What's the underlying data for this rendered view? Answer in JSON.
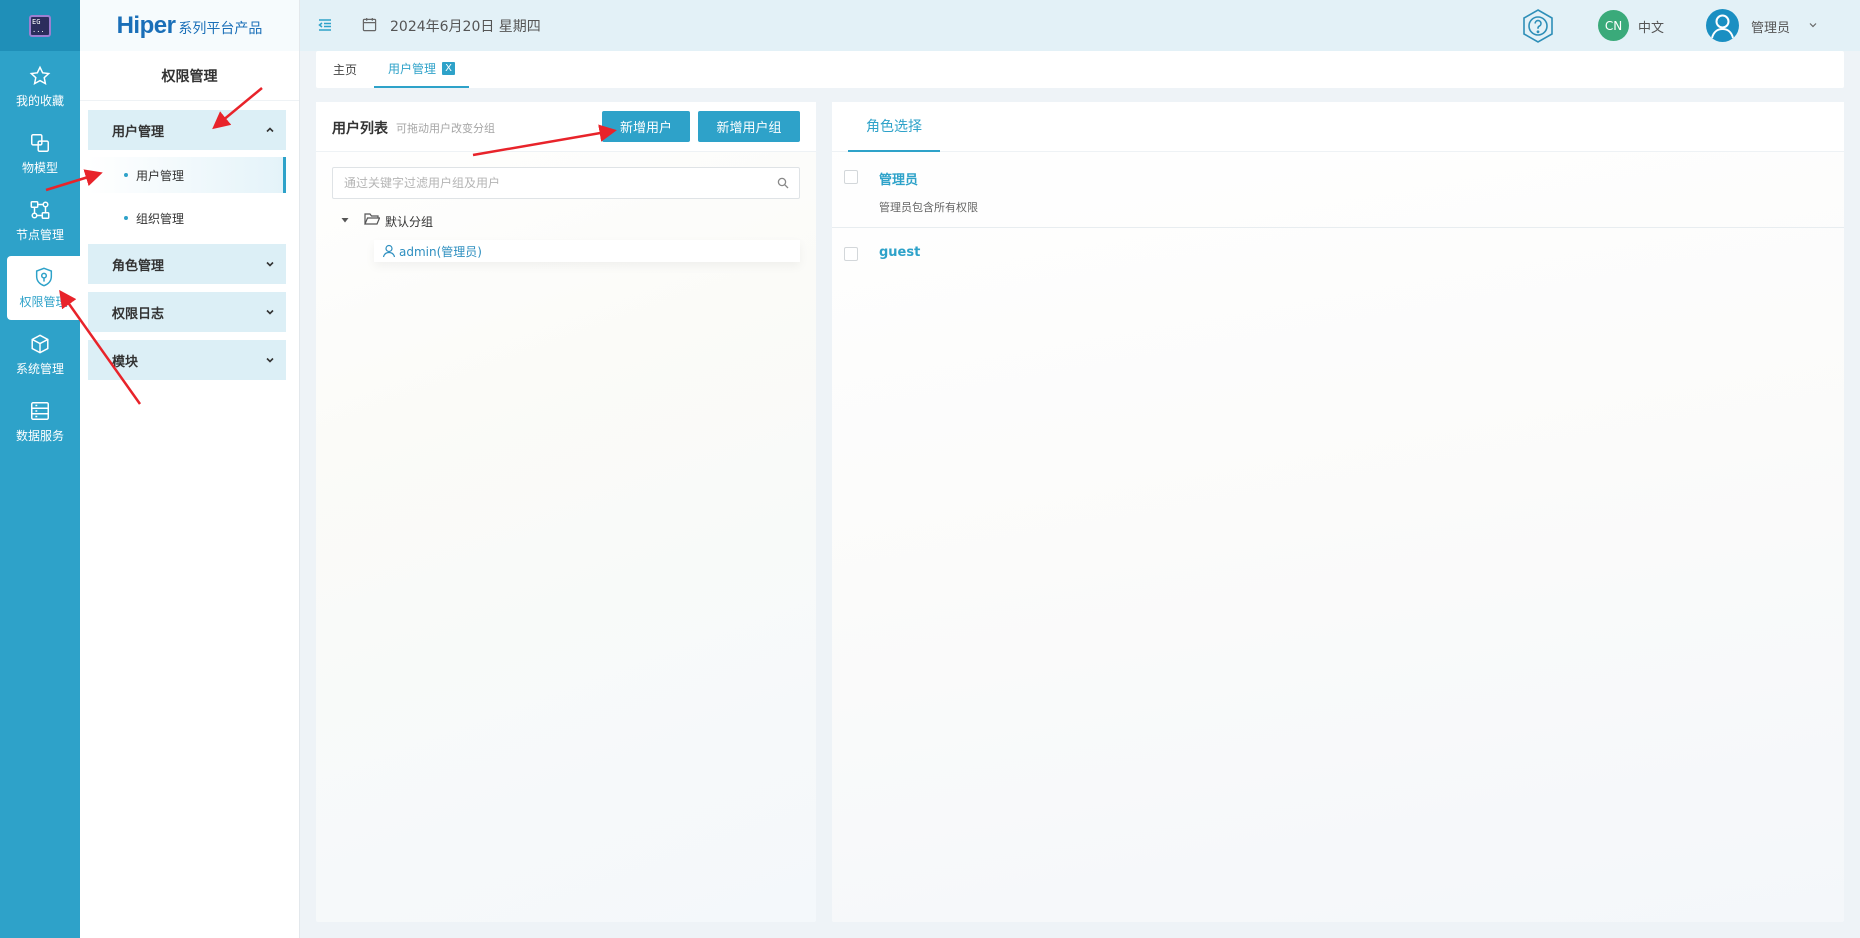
{
  "app": {
    "logo_text": "EG\n...",
    "brand_main": "Hiper",
    "brand_sub": "系列平台产品"
  },
  "rail": {
    "items": [
      {
        "label": "我的收藏",
        "icon": "star-icon"
      },
      {
        "label": "物模型",
        "icon": "model-icon"
      },
      {
        "label": "节点管理",
        "icon": "node-icon"
      },
      {
        "label": "权限管理",
        "icon": "shield-icon",
        "active": true
      },
      {
        "label": "系统管理",
        "icon": "cube-icon"
      },
      {
        "label": "数据服务",
        "icon": "database-icon"
      }
    ]
  },
  "menu": {
    "title": "权限管理",
    "groups": [
      {
        "label": "用户管理",
        "expanded": true,
        "children": [
          {
            "label": "用户管理",
            "active": true
          },
          {
            "label": "组织管理"
          }
        ]
      },
      {
        "label": "角色管理",
        "expanded": false
      },
      {
        "label": "权限日志",
        "expanded": false
      },
      {
        "label": "模块",
        "expanded": false
      }
    ]
  },
  "header": {
    "date": "2024年6月20日 星期四",
    "lang_badge": "CN",
    "lang_label": "中文",
    "user_name": "管理员"
  },
  "tabs": {
    "home": "主页",
    "current": "用户管理",
    "close": "X"
  },
  "user_panel": {
    "title": "用户列表",
    "hint": "可拖动用户改变分组",
    "add_user": "新增用户",
    "add_group": "新增用户组",
    "search_placeholder": "通过关键字过滤用户组及用户",
    "group_name": "默认分组",
    "users": [
      "admin(管理员)"
    ]
  },
  "role_panel": {
    "tab": "角色选择",
    "roles": [
      {
        "name": "管理员",
        "desc": "管理员包含所有权限"
      },
      {
        "name": "guest",
        "desc": ""
      }
    ]
  },
  "colors": {
    "primary": "#2ea2c9",
    "rail_bg": "#2ea2c9",
    "menu_group_bg": "#dceff6",
    "annotation_arrow": "#e8232a"
  }
}
